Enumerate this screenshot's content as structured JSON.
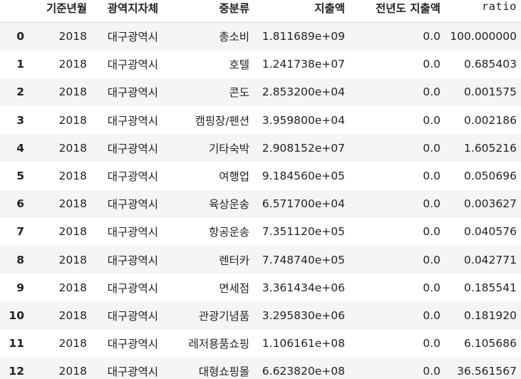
{
  "columns": {
    "index": "",
    "year_month": "기준년월",
    "region": "광역지자체",
    "category": "중분류",
    "amount": "지출액",
    "prev_amount": "전년도 지출액",
    "ratio": "ratio"
  },
  "rows": [
    {
      "idx": "0",
      "year_month": "2018",
      "region": "대구광역시",
      "category": "총소비",
      "amount": "1.811689e+09",
      "prev_amount": "0.0",
      "ratio": "100.000000"
    },
    {
      "idx": "1",
      "year_month": "2018",
      "region": "대구광역시",
      "category": "호텔",
      "amount": "1.241738e+07",
      "prev_amount": "0.0",
      "ratio": "0.685403"
    },
    {
      "idx": "2",
      "year_month": "2018",
      "region": "대구광역시",
      "category": "콘도",
      "amount": "2.853200e+04",
      "prev_amount": "0.0",
      "ratio": "0.001575"
    },
    {
      "idx": "3",
      "year_month": "2018",
      "region": "대구광역시",
      "category": "캠핑장/펜션",
      "amount": "3.959800e+04",
      "prev_amount": "0.0",
      "ratio": "0.002186"
    },
    {
      "idx": "4",
      "year_month": "2018",
      "region": "대구광역시",
      "category": "기타숙박",
      "amount": "2.908152e+07",
      "prev_amount": "0.0",
      "ratio": "1.605216"
    },
    {
      "idx": "5",
      "year_month": "2018",
      "region": "대구광역시",
      "category": "여행업",
      "amount": "9.184560e+05",
      "prev_amount": "0.0",
      "ratio": "0.050696"
    },
    {
      "idx": "6",
      "year_month": "2018",
      "region": "대구광역시",
      "category": "육상운송",
      "amount": "6.571700e+04",
      "prev_amount": "0.0",
      "ratio": "0.003627"
    },
    {
      "idx": "7",
      "year_month": "2018",
      "region": "대구광역시",
      "category": "항공운송",
      "amount": "7.351120e+05",
      "prev_amount": "0.0",
      "ratio": "0.040576"
    },
    {
      "idx": "8",
      "year_month": "2018",
      "region": "대구광역시",
      "category": "렌터카",
      "amount": "7.748740e+05",
      "prev_amount": "0.0",
      "ratio": "0.042771"
    },
    {
      "idx": "9",
      "year_month": "2018",
      "region": "대구광역시",
      "category": "면세점",
      "amount": "3.361434e+06",
      "prev_amount": "0.0",
      "ratio": "0.185541"
    },
    {
      "idx": "10",
      "year_month": "2018",
      "region": "대구광역시",
      "category": "관광기념품",
      "amount": "3.295830e+06",
      "prev_amount": "0.0",
      "ratio": "0.181920"
    },
    {
      "idx": "11",
      "year_month": "2018",
      "region": "대구광역시",
      "category": "레저용품쇼핑",
      "amount": "1.106161e+08",
      "prev_amount": "0.0",
      "ratio": "6.105686"
    },
    {
      "idx": "12",
      "year_month": "2018",
      "region": "대구광역시",
      "category": "대형쇼핑몰",
      "amount": "6.623820e+08",
      "prev_amount": "0.0",
      "ratio": "36.561567"
    }
  ]
}
